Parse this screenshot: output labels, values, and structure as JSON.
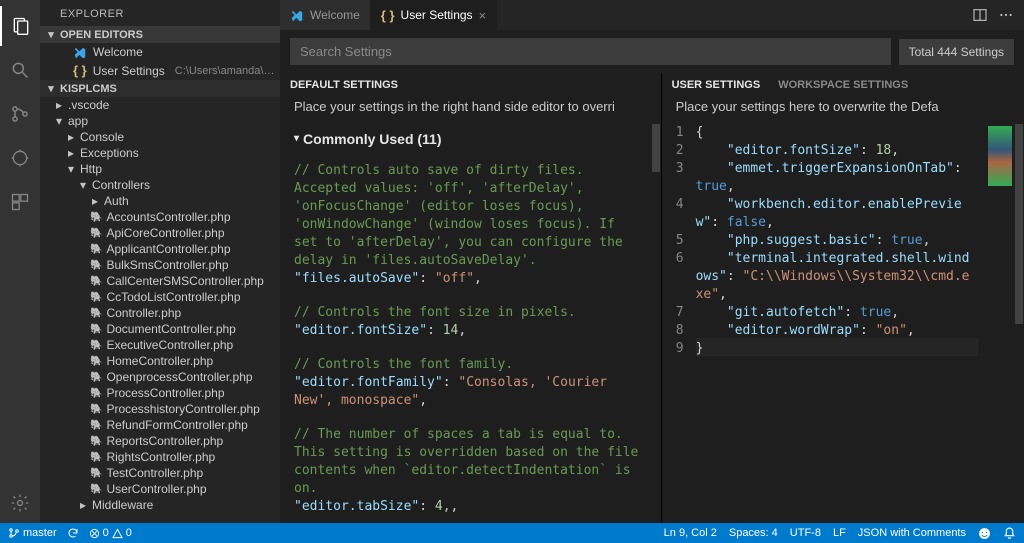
{
  "sidebar": {
    "title": "EXPLORER",
    "openEditorsLabel": "OPEN EDITORS",
    "openEditors": [
      {
        "icon": "vscode",
        "name": "Welcome"
      },
      {
        "icon": "braces",
        "name": "User Settings",
        "path": "C:\\Users\\amanda\\AppData\\Roam..."
      }
    ],
    "projectLabel": "KISPLCMS",
    "tree": [
      {
        "d": 0,
        "t": "folder",
        "open": false,
        "name": ".vscode"
      },
      {
        "d": 0,
        "t": "folder",
        "open": true,
        "name": "app"
      },
      {
        "d": 1,
        "t": "folder",
        "open": false,
        "name": "Console"
      },
      {
        "d": 1,
        "t": "folder",
        "open": false,
        "name": "Exceptions"
      },
      {
        "d": 1,
        "t": "folder",
        "open": true,
        "name": "Http"
      },
      {
        "d": 2,
        "t": "folder",
        "open": true,
        "name": "Controllers"
      },
      {
        "d": 3,
        "t": "folder",
        "open": false,
        "name": "Auth"
      },
      {
        "d": 3,
        "t": "php",
        "name": "AccountsController.php"
      },
      {
        "d": 3,
        "t": "php",
        "name": "ApiCoreController.php"
      },
      {
        "d": 3,
        "t": "php",
        "name": "ApplicantController.php"
      },
      {
        "d": 3,
        "t": "php",
        "name": "BulkSmsController.php"
      },
      {
        "d": 3,
        "t": "php",
        "name": "CallCenterSMSController.php"
      },
      {
        "d": 3,
        "t": "php",
        "name": "CcTodoListController.php"
      },
      {
        "d": 3,
        "t": "php",
        "name": "Controller.php"
      },
      {
        "d": 3,
        "t": "php",
        "name": "DocumentController.php"
      },
      {
        "d": 3,
        "t": "php",
        "name": "ExecutiveController.php"
      },
      {
        "d": 3,
        "t": "php",
        "name": "HomeController.php"
      },
      {
        "d": 3,
        "t": "php",
        "name": "OpenprocessController.php"
      },
      {
        "d": 3,
        "t": "php",
        "name": "ProcessController.php"
      },
      {
        "d": 3,
        "t": "php",
        "name": "ProcesshistoryController.php"
      },
      {
        "d": 3,
        "t": "php",
        "name": "RefundFormController.php"
      },
      {
        "d": 3,
        "t": "php",
        "name": "ReportsController.php"
      },
      {
        "d": 3,
        "t": "php",
        "name": "RightsController.php"
      },
      {
        "d": 3,
        "t": "php",
        "name": "TestController.php"
      },
      {
        "d": 3,
        "t": "php",
        "name": "UserController.php"
      },
      {
        "d": 2,
        "t": "folder",
        "open": false,
        "name": "Middleware"
      }
    ]
  },
  "tabs": [
    {
      "icon": "vscode",
      "label": "Welcome",
      "active": false
    },
    {
      "icon": "braces",
      "label": "User Settings",
      "active": true
    }
  ],
  "search": {
    "placeholder": "Search Settings",
    "total": "Total 444 Settings"
  },
  "leftPane": {
    "head": "DEFAULT SETTINGS",
    "sub": "Place your settings in the right hand side editor to overri",
    "groupTitle": "Commonly Used (11)",
    "blocks": [
      {
        "comment": "// Controls auto save of dirty files. Accepted values:  'off', 'afterDelay', 'onFocusChange' (editor loses focus), 'onWindowChange' (window loses focus). If set to 'afterDelay', you can configure the delay in 'files.autoSaveDelay'.",
        "key": "files.autoSave",
        "value": "\"off\"",
        "vtype": "str"
      },
      {
        "comment": "// Controls the font size in pixels.",
        "key": "editor.fontSize",
        "value": "14",
        "vtype": "num"
      },
      {
        "comment": "// Controls the font family.",
        "key": "editor.fontFamily",
        "value": "\"Consolas, 'Courier New', monospace\"",
        "vtype": "str"
      },
      {
        "comment": "// The number of spaces a tab is equal to. This setting is overridden based on the file contents when `editor.detectIndentation` is on.",
        "key": "editor.tabSize",
        "value": "4,",
        "vtype": "num"
      }
    ]
  },
  "rightPane": {
    "headTabs": [
      "USER SETTINGS",
      "WORKSPACE SETTINGS"
    ],
    "sub": "Place your settings here to overwrite the Defa",
    "code": [
      {
        "n": 1,
        "html": "{"
      },
      {
        "n": 2,
        "html": "    <span class='key'>\"editor.fontSize\"</span>: <span class='num'>18</span>,"
      },
      {
        "n": 3,
        "html": "    <span class='key'>\"emmet.triggerExpansionOnTab\"</span>: <span class='bool'>true</span>,"
      },
      {
        "n": 4,
        "html": "    <span class='key'>\"workbench.editor.enablePreview\"</span>: <span class='bool'>false</span>,"
      },
      {
        "n": 5,
        "html": "    <span class='key'>\"php.suggest.basic\"</span>: <span class='bool'>true</span>,"
      },
      {
        "n": 6,
        "html": "    <span class='key'>\"terminal.integrated.shell.windows\"</span>: <span class='str'>\"C:\\\\Windows\\\\System32\\\\cmd.exe\"</span>,"
      },
      {
        "n": 7,
        "html": "    <span class='key'>\"git.autofetch\"</span>: <span class='bool'>true</span>,"
      },
      {
        "n": 8,
        "html": "    <span class='key'>\"editor.wordWrap\"</span>: <span class='str'>\"on\"</span>,"
      },
      {
        "n": 9,
        "html": "}"
      }
    ]
  },
  "status": {
    "branch": "master",
    "sync": "0↓ 0↑",
    "problems": "0",
    "lncol": "Ln 9, Col 2",
    "spaces": "Spaces: 4",
    "enc": "UTF-8",
    "eol": "LF",
    "lang": "JSON with Comments"
  }
}
